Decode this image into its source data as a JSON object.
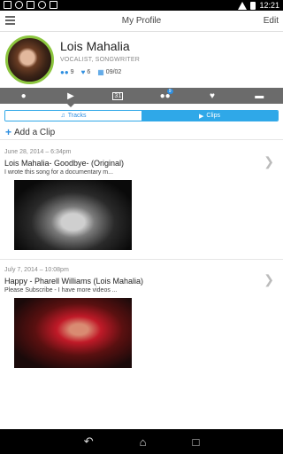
{
  "status_bar": {
    "time": "12:21"
  },
  "app_bar": {
    "title": "My Profile",
    "edit_label": "Edit"
  },
  "profile": {
    "name": "Lois Mahalia",
    "role": "VOCALIST, SONGWRITER",
    "stats": {
      "fans": "9",
      "likes": "6",
      "date": "09/02"
    }
  },
  "icon_tabs": [
    {
      "name": "tab-profile",
      "glyph": "●"
    },
    {
      "name": "tab-media",
      "glyph": "▶"
    },
    {
      "name": "tab-calendar",
      "glyph": "31"
    },
    {
      "name": "tab-fans",
      "glyph": "●●",
      "badge": "9"
    },
    {
      "name": "tab-likes",
      "glyph": "♥"
    },
    {
      "name": "tab-messages",
      "glyph": "▬"
    }
  ],
  "segments": {
    "tracks": "Tracks",
    "clips": "Clips"
  },
  "add_clip_label": "Add a Clip",
  "clips": [
    {
      "date": "June 28, 2014 – 6:34pm",
      "title": "Lois Mahalia- Goodbye- (Original)",
      "description": "I wrote this song for a documentary m..."
    },
    {
      "date": "July 7, 2014 – 10:08pm",
      "title": "Happy - Pharell Williams (Lois Mahalia)",
      "description": "Please Subscribe - I have more videos ..."
    }
  ],
  "colors": {
    "accent": "#2fa8e8",
    "avatar_ring": "#8cc63f",
    "tabbar": "#6b6b6b"
  }
}
